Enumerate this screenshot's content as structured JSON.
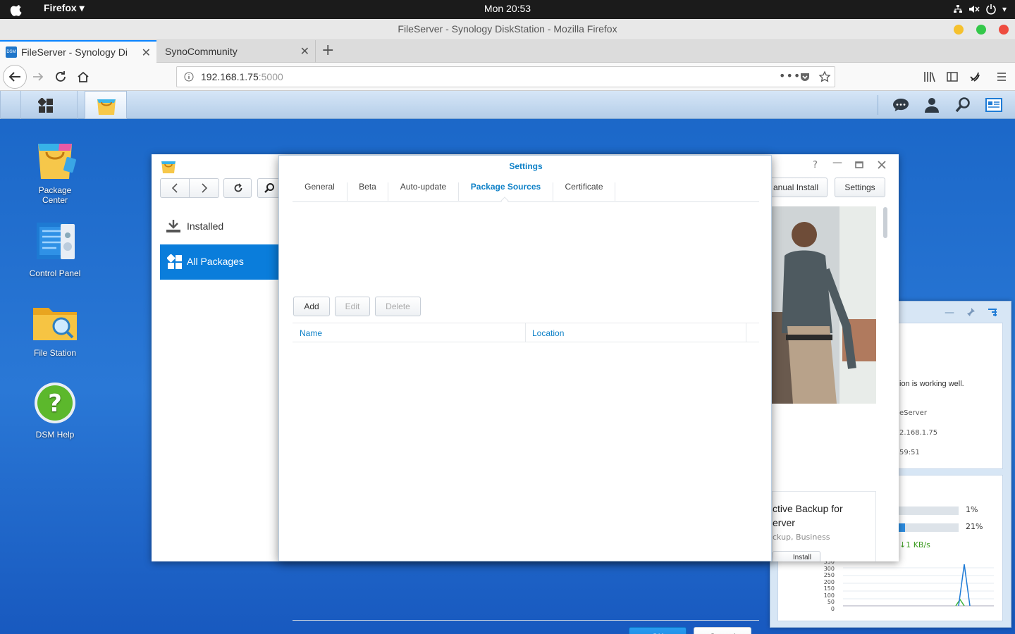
{
  "os_bar": {
    "app_name": "Firefox",
    "clock": "Mon 20:53"
  },
  "browser": {
    "window_title": "FileServer - Synology DiskStation - Mozilla Firefox",
    "tabs": [
      {
        "label": "FileServer - Synology Di",
        "active": true
      },
      {
        "label": "SynoCommunity",
        "active": false
      }
    ],
    "url_host": "192.168.1.75",
    "url_port": ":5000"
  },
  "desktop_icons": [
    {
      "label_line1": "Package",
      "label_line2": "Center"
    },
    {
      "label_line1": "Control Panel",
      "label_line2": ""
    },
    {
      "label_line1": "File Station",
      "label_line2": ""
    },
    {
      "label_line1": "DSM Help",
      "label_line2": ""
    }
  ],
  "package_center": {
    "sidebar": {
      "installed": "Installed",
      "all_packages": "All Packages"
    },
    "toolbar": {
      "manual_install": "anual Install",
      "settings": "Settings"
    },
    "card": {
      "title_line1": "ctive Backup for",
      "title_line2": "erver",
      "category": "ckup, Business",
      "install": "Install"
    }
  },
  "widget": {
    "status_text": "ion is working well.",
    "server_name": "eServer",
    "ip": "2.168.1.75",
    "uptime": "59:51",
    "cpu_percent": "1%",
    "cpu_value": 1,
    "ram_percent": "21%",
    "ram_value": 21,
    "network": "1 KB/s",
    "chart_ticks": [
      "350",
      "300",
      "250",
      "200",
      "150",
      "100",
      "50",
      "0"
    ]
  },
  "settings_dialog": {
    "title": "Settings",
    "tabs": [
      "General",
      "Beta",
      "Auto-update",
      "Package Sources",
      "Certificate"
    ],
    "selected_tab": "Package Sources",
    "buttons": {
      "add": "Add",
      "edit": "Edit",
      "delete": "Delete"
    },
    "columns": {
      "name": "Name",
      "location": "Location"
    },
    "footer": {
      "ok": "OK",
      "cancel": "Cancel"
    }
  },
  "colors": {
    "accent": "#0a7ddb",
    "title_blue": "#0d80c7",
    "desktop": "#1a66c7"
  }
}
